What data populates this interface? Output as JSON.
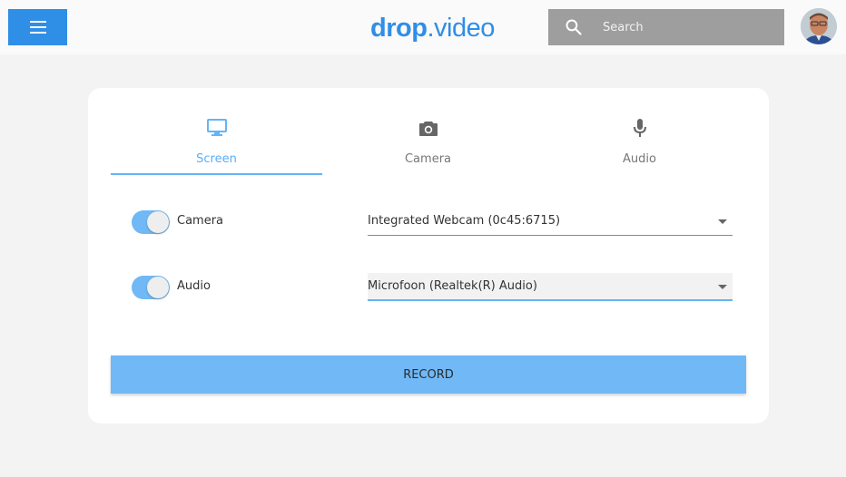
{
  "header": {
    "logo": {
      "part1": "drop",
      "part2": ".video"
    },
    "search": {
      "placeholder": "Search"
    }
  },
  "tabs": [
    {
      "label": "Screen",
      "icon": "monitor-icon",
      "active": true
    },
    {
      "label": "Camera",
      "icon": "camera-icon",
      "active": false
    },
    {
      "label": "Audio",
      "icon": "microphone-icon",
      "active": false
    }
  ],
  "settings": {
    "camera": {
      "label": "Camera",
      "enabled": true,
      "device": "Integrated Webcam (0c45:6715)"
    },
    "audio": {
      "label": "Audio",
      "enabled": true,
      "device": "Microfoon (Realtek(R) Audio)"
    }
  },
  "record_label": "RECORD",
  "colors": {
    "brand": "#2f8ee6",
    "accent": "#64b5f6",
    "toggle_on": "#70b8f6",
    "search_bg": "#9e9e9e",
    "page_bg": "#f3f3f3"
  }
}
